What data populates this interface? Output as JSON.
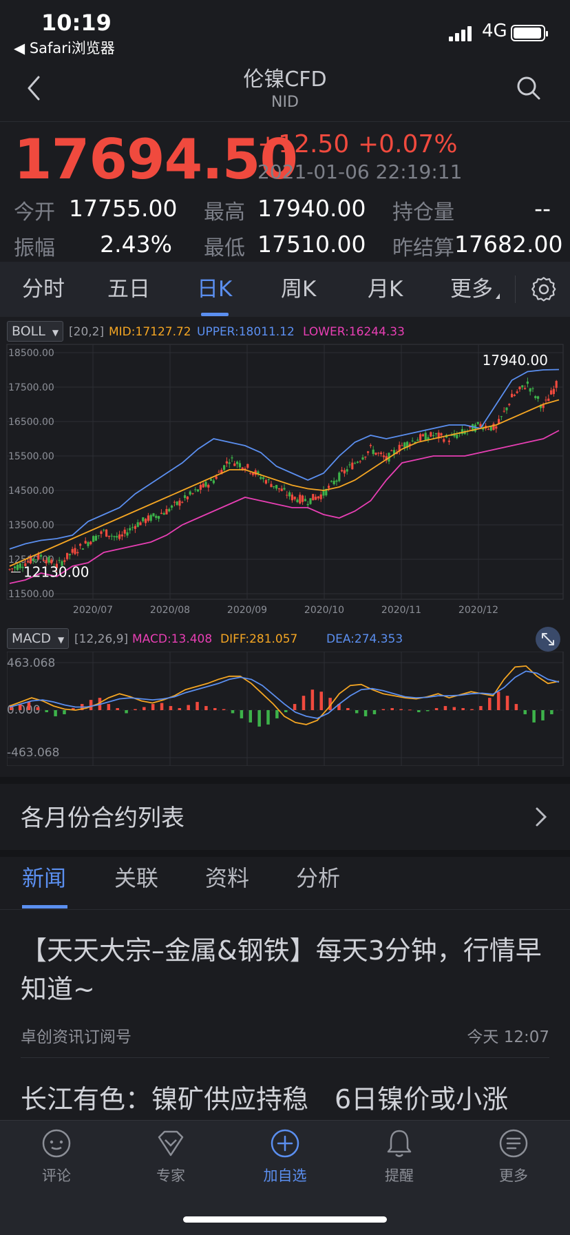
{
  "status": {
    "time": "10:19",
    "back_app": "◀ Safari浏览器",
    "network": "4G"
  },
  "nav": {
    "title": "伦镍CFD",
    "subtitle": "NID"
  },
  "quote": {
    "price": "17694.50",
    "change": "+12.50",
    "change_pct": "+0.07%",
    "datetime": "2021-01-06 22:19:11",
    "fields": [
      {
        "label": "今开",
        "value": "17755.00"
      },
      {
        "label": "最高",
        "value": "17940.00"
      },
      {
        "label": "持仓量",
        "value": "--"
      },
      {
        "label": "振幅",
        "value": "2.43%"
      },
      {
        "label": "最低",
        "value": "17510.00"
      },
      {
        "label": "昨结算",
        "value": "17682.00"
      }
    ]
  },
  "ktabs": [
    "分时",
    "五日",
    "日K",
    "周K",
    "月K",
    "更多"
  ],
  "ktab_active": 2,
  "boll": {
    "select": "BOLL",
    "params": "[20,2]",
    "mid": "MID:17127.72",
    "upper": "UPPER:18011.12",
    "lower": "LOWER:16244.33"
  },
  "macd": {
    "select": "MACD",
    "params": "[12,26,9]",
    "macd": "MACD:13.408",
    "diff": "DIFF:281.057",
    "dea": "DEA:274.353"
  },
  "colors": {
    "up": "#f04a3e",
    "down": "#3db24a",
    "mid": "#f5a623",
    "upper": "#5b8ff0",
    "lower": "#e83fb4",
    "accent": "#5b8ff0"
  },
  "chart_data": [
    {
      "type": "candlestick",
      "title": "",
      "y_ticks": [
        "18500.00",
        "17500.00",
        "16500.00",
        "15500.00",
        "14500.00",
        "13500.00",
        "12500.00",
        "11500.00"
      ],
      "ylim": [
        11500,
        18500
      ],
      "x_ticks": [
        "2020/07",
        "2020/08",
        "2020/09",
        "2020/10",
        "2020/11",
        "2020/12"
      ],
      "annotations": {
        "high": "17940.00",
        "low": "12130.00"
      },
      "series": [
        {
          "name": "MID",
          "values": [
            12300,
            12500,
            12700,
            12900,
            13100,
            13300,
            13500,
            13700,
            13900,
            14100,
            14300,
            14500,
            14700,
            14900,
            15100,
            15100,
            14950,
            14800,
            14650,
            14550,
            14500,
            14600,
            14800,
            15100,
            15400,
            15700,
            15900,
            16000,
            16100,
            16200,
            16300,
            16400,
            16600,
            16800,
            17000,
            17130
          ]
        },
        {
          "name": "UPPER",
          "values": [
            12800,
            12950,
            13050,
            13100,
            13200,
            13600,
            13800,
            14000,
            14400,
            14700,
            15000,
            15300,
            15700,
            16000,
            15900,
            15800,
            15600,
            15200,
            15000,
            14800,
            15000,
            15500,
            15900,
            16100,
            16000,
            16100,
            16200,
            16300,
            16400,
            16400,
            16300,
            17000,
            17700,
            17950,
            18000,
            18010
          ]
        },
        {
          "name": "LOWER",
          "values": [
            11800,
            11900,
            12100,
            12000,
            12300,
            12400,
            12700,
            12800,
            12900,
            13000,
            13200,
            13500,
            13700,
            13900,
            14100,
            14300,
            14200,
            14100,
            14000,
            14000,
            13800,
            13700,
            13900,
            14200,
            14800,
            15300,
            15400,
            15500,
            15500,
            15500,
            15600,
            15700,
            15800,
            15900,
            16000,
            16240
          ]
        },
        {
          "name": "CLOSE",
          "values": [
            12200,
            12400,
            12600,
            12300,
            12700,
            13000,
            13300,
            13100,
            13500,
            13700,
            13900,
            14200,
            14500,
            14800,
            15400,
            15200,
            14900,
            14600,
            14300,
            14200,
            14400,
            14900,
            15300,
            15700,
            15400,
            15800,
            16000,
            16100,
            16000,
            16200,
            16400,
            16300,
            17200,
            17600,
            16900,
            17690
          ]
        }
      ]
    },
    {
      "type": "bar",
      "title": "",
      "y_ticks": [
        "463.068",
        "0.000",
        "-463.068"
      ],
      "ylim": [
        -463.068,
        463.068
      ],
      "series": [
        {
          "name": "MACD",
          "values": [
            40,
            60,
            80,
            30,
            -20,
            -60,
            -40,
            20,
            60,
            100,
            120,
            60,
            20,
            -30,
            10,
            30,
            60,
            70,
            40,
            20,
            50,
            80,
            40,
            20,
            10,
            -30,
            -80,
            -120,
            -160,
            -140,
            -80,
            -20,
            60,
            140,
            200,
            180,
            120,
            60,
            20,
            -30,
            -60,
            -40,
            10,
            20,
            10,
            5,
            -20,
            -10,
            20,
            40,
            30,
            20,
            10,
            40,
            120,
            180,
            140,
            60,
            -40,
            -120,
            -100,
            -40
          ]
        },
        {
          "name": "DIFF",
          "values": [
            40,
            80,
            120,
            90,
            40,
            10,
            0,
            20,
            60,
            120,
            160,
            130,
            90,
            70,
            100,
            140,
            200,
            230,
            260,
            300,
            330,
            330,
            260,
            160,
            60,
            -60,
            -120,
            -140,
            -100,
            20,
            160,
            240,
            250,
            200,
            160,
            140,
            120,
            110,
            130,
            160,
            120,
            150,
            180,
            160,
            140,
            300,
            420,
            430,
            330,
            260,
            281
          ]
        },
        {
          "name": "DEA",
          "values": [
            30,
            60,
            90,
            100,
            80,
            50,
            30,
            30,
            50,
            80,
            110,
            120,
            110,
            100,
            110,
            130,
            170,
            200,
            230,
            260,
            300,
            320,
            300,
            240,
            150,
            60,
            -20,
            -60,
            -80,
            -30,
            60,
            140,
            200,
            210,
            190,
            160,
            130,
            120,
            125,
            140,
            140,
            145,
            160,
            165,
            155,
            220,
            320,
            380,
            360,
            300,
            274
          ]
        }
      ]
    }
  ],
  "contract_list": {
    "label": "各月份合约列表"
  },
  "news_tabs": [
    "新闻",
    "关联",
    "资料",
    "分析"
  ],
  "news": [
    {
      "title": "【天天大宗–金属&钢铁】每天3分钟，行情早知道~",
      "source": "卓创资讯订阅号",
      "time": "今天 12:07"
    },
    {
      "title": "长江有色：镍矿供应持稳　6日镍价或小涨"
    }
  ],
  "tabbar": [
    {
      "label": "评论",
      "icon": "comment-icon"
    },
    {
      "label": "专家",
      "icon": "expert-icon"
    },
    {
      "label": "加自选",
      "icon": "add-watchlist-icon"
    },
    {
      "label": "提醒",
      "icon": "bell-icon"
    },
    {
      "label": "更多",
      "icon": "more-icon"
    }
  ]
}
